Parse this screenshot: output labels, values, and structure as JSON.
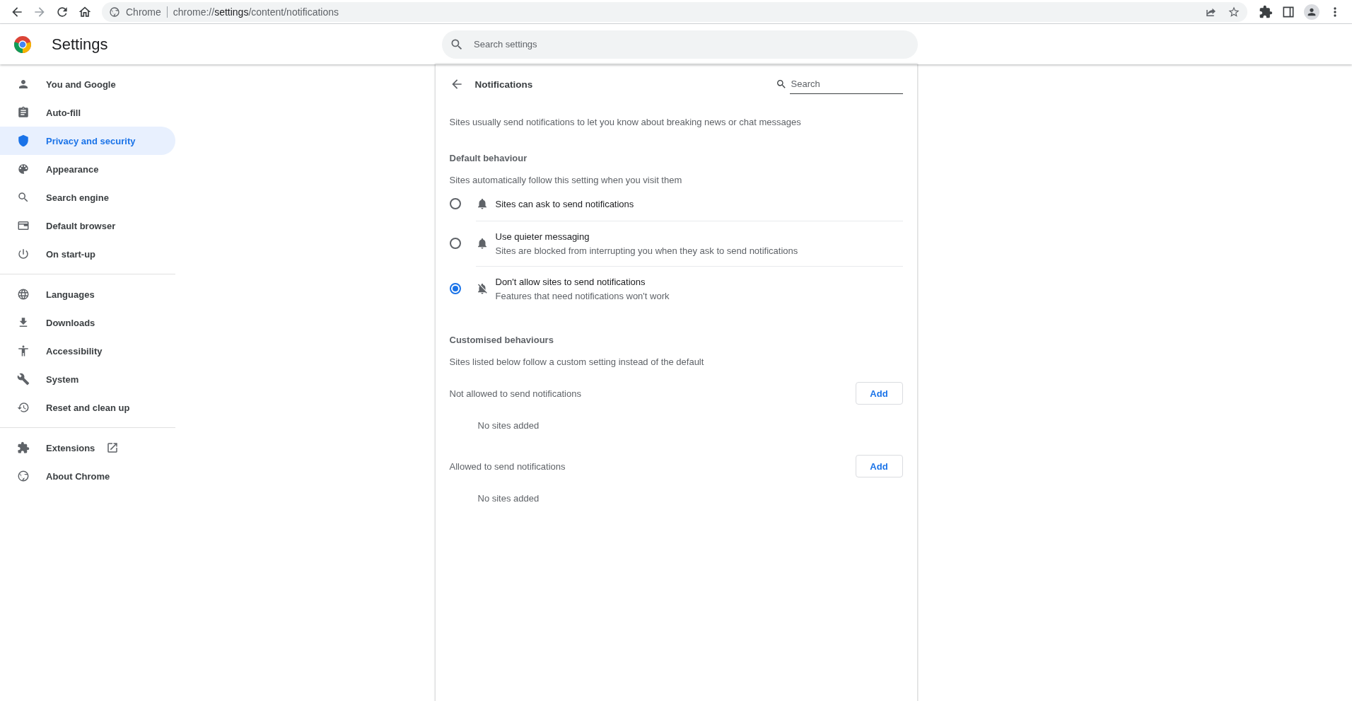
{
  "browser": {
    "site_label": "Chrome",
    "url": {
      "scheme": "chrome://",
      "host": "settings",
      "path": "/content/notifications"
    }
  },
  "header": {
    "title": "Settings",
    "search": {
      "placeholder": "Search settings"
    }
  },
  "sidebar": {
    "groups": [
      {
        "items": [
          {
            "label": "You and Google",
            "selected": false,
            "opens_externally": false
          },
          {
            "label": "Auto-fill",
            "selected": false,
            "opens_externally": false
          },
          {
            "label": "Privacy and security",
            "selected": true,
            "opens_externally": false
          },
          {
            "label": "Appearance",
            "selected": false,
            "opens_externally": false
          },
          {
            "label": "Search engine",
            "selected": false,
            "opens_externally": false
          },
          {
            "label": "Default browser",
            "selected": false,
            "opens_externally": false
          },
          {
            "label": "On start-up",
            "selected": false,
            "opens_externally": false
          }
        ]
      },
      {
        "items": [
          {
            "label": "Languages",
            "selected": false,
            "opens_externally": false
          },
          {
            "label": "Downloads",
            "selected": false,
            "opens_externally": false
          },
          {
            "label": "Accessibility",
            "selected": false,
            "opens_externally": false
          },
          {
            "label": "System",
            "selected": false,
            "opens_externally": false
          },
          {
            "label": "Reset and clean up",
            "selected": false,
            "opens_externally": false
          }
        ]
      },
      {
        "items": [
          {
            "label": "Extensions",
            "selected": false,
            "opens_externally": true
          },
          {
            "label": "About Chrome",
            "selected": false,
            "opens_externally": false
          }
        ]
      }
    ]
  },
  "page": {
    "title": "Notifications",
    "search": {
      "placeholder": "Search"
    },
    "description": "Sites usually send notifications to let you know about breaking news or chat messages",
    "default_behaviour": {
      "heading": "Default behaviour",
      "subtitle": "Sites automatically follow this setting when you visit them",
      "options": [
        {
          "kind": "bell",
          "label": "Sites can ask to send notifications",
          "selected": false
        },
        {
          "kind": "bell",
          "label": "Use quieter messaging",
          "sublabel": "Sites are blocked from interrupting you when they ask to send notifications",
          "selected": false
        },
        {
          "kind": "muted",
          "label": "Don't allow sites to send notifications",
          "sublabel": "Features that need notifications won't work",
          "selected": true
        }
      ]
    },
    "customised_behaviours": {
      "heading": "Customised behaviours",
      "subtitle": "Sites listed below follow a custom setting instead of the default",
      "lists": [
        {
          "label": "Not allowed to send notifications",
          "button": "Add",
          "empty_text": "No sites added"
        },
        {
          "label": "Allowed to send notifications",
          "button": "Add",
          "empty_text": "No sites added"
        }
      ]
    }
  }
}
